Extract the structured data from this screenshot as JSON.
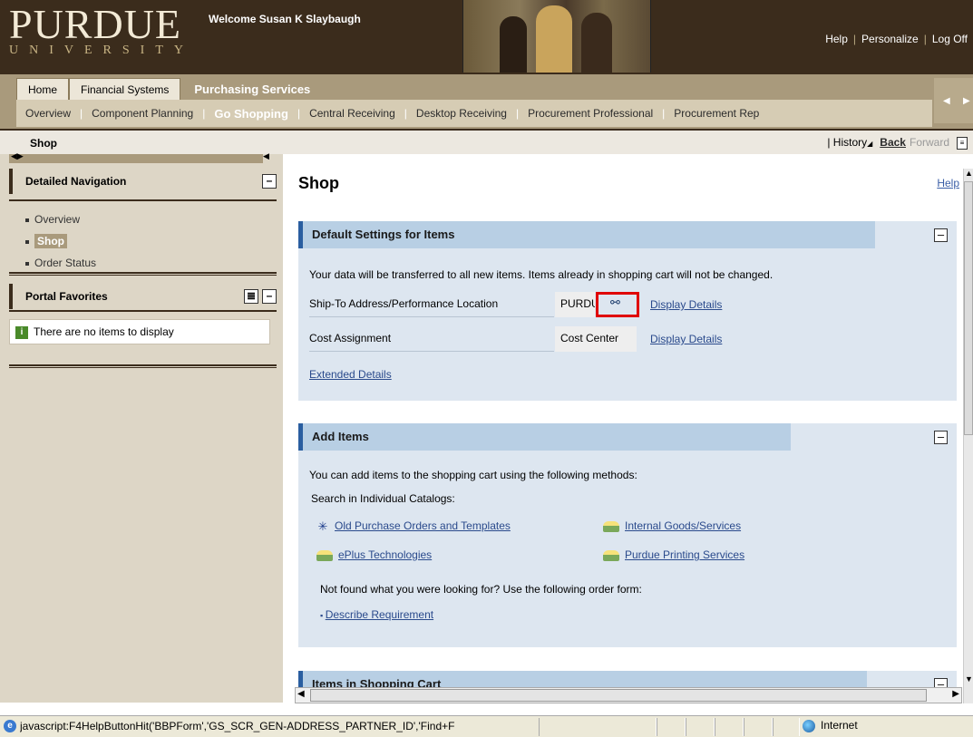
{
  "header": {
    "logo_main": "PURDUE",
    "logo_sub": "UNIVERSITY",
    "welcome": "Welcome Susan K Slaybaugh",
    "links": [
      "Help",
      "Personalize",
      "Log Off"
    ]
  },
  "topnav": {
    "level1": [
      "Home",
      "Financial Systems",
      "Purchasing Services"
    ],
    "level1_active": "Purchasing Services",
    "level2": [
      "Overview",
      "Component Planning",
      "Go Shopping",
      "Central Receiving",
      "Desktop Receiving",
      "Procurement Professional",
      "Procurement Rep"
    ],
    "level2_active": "Go Shopping"
  },
  "titlebar": {
    "page_title": "Shop",
    "history": "History",
    "back": "Back",
    "forward": "Forward"
  },
  "leftpanel": {
    "detailed_navigation": "Detailed Navigation",
    "nav_items": [
      "Overview",
      "Shop",
      "Order Status"
    ],
    "nav_active": "Shop",
    "portal_favorites": "Portal Favorites",
    "favorites_empty": "There are no items to display"
  },
  "main": {
    "title": "Shop",
    "help": "Help",
    "default_settings": {
      "header": "Default Settings for Items",
      "note": "Your data will be transferred to all new items. Items already in shopping cart will not be changed.",
      "ship_to_label": "Ship-To Address/Performance Location",
      "ship_to_value": "PURDUE",
      "cost_label": "Cost Assignment",
      "cost_value": "Cost Center",
      "display_details": "Display Details",
      "extended_details": "Extended Details"
    },
    "add_items": {
      "header": "Add Items",
      "intro": "You can add items to the shopping cart using the following methods:",
      "search_label": "Search in Individual Catalogs:",
      "catalogs": [
        "Old Purchase Orders and Templates",
        "Internal Goods/Services",
        "ePlus Technologies",
        "Purdue Printing Services"
      ],
      "not_found": "Not found what you were looking for? Use the following order form:",
      "describe": "Describe Requirement"
    },
    "cart": {
      "header": "Items in Shopping Cart"
    }
  },
  "statusbar": {
    "text": "javascript:F4HelpButtonHit('BBPForm','GS_SCR_GEN-ADDRESS_PARTNER_ID','Find+F",
    "zone": "Internet"
  },
  "colors": {
    "header_bg": "#3b2c1c",
    "nav_bg": "#a99a7c",
    "tray_bg": "#dde6f0",
    "tray_header": "#b8cfe4",
    "highlight": "#e00000"
  }
}
